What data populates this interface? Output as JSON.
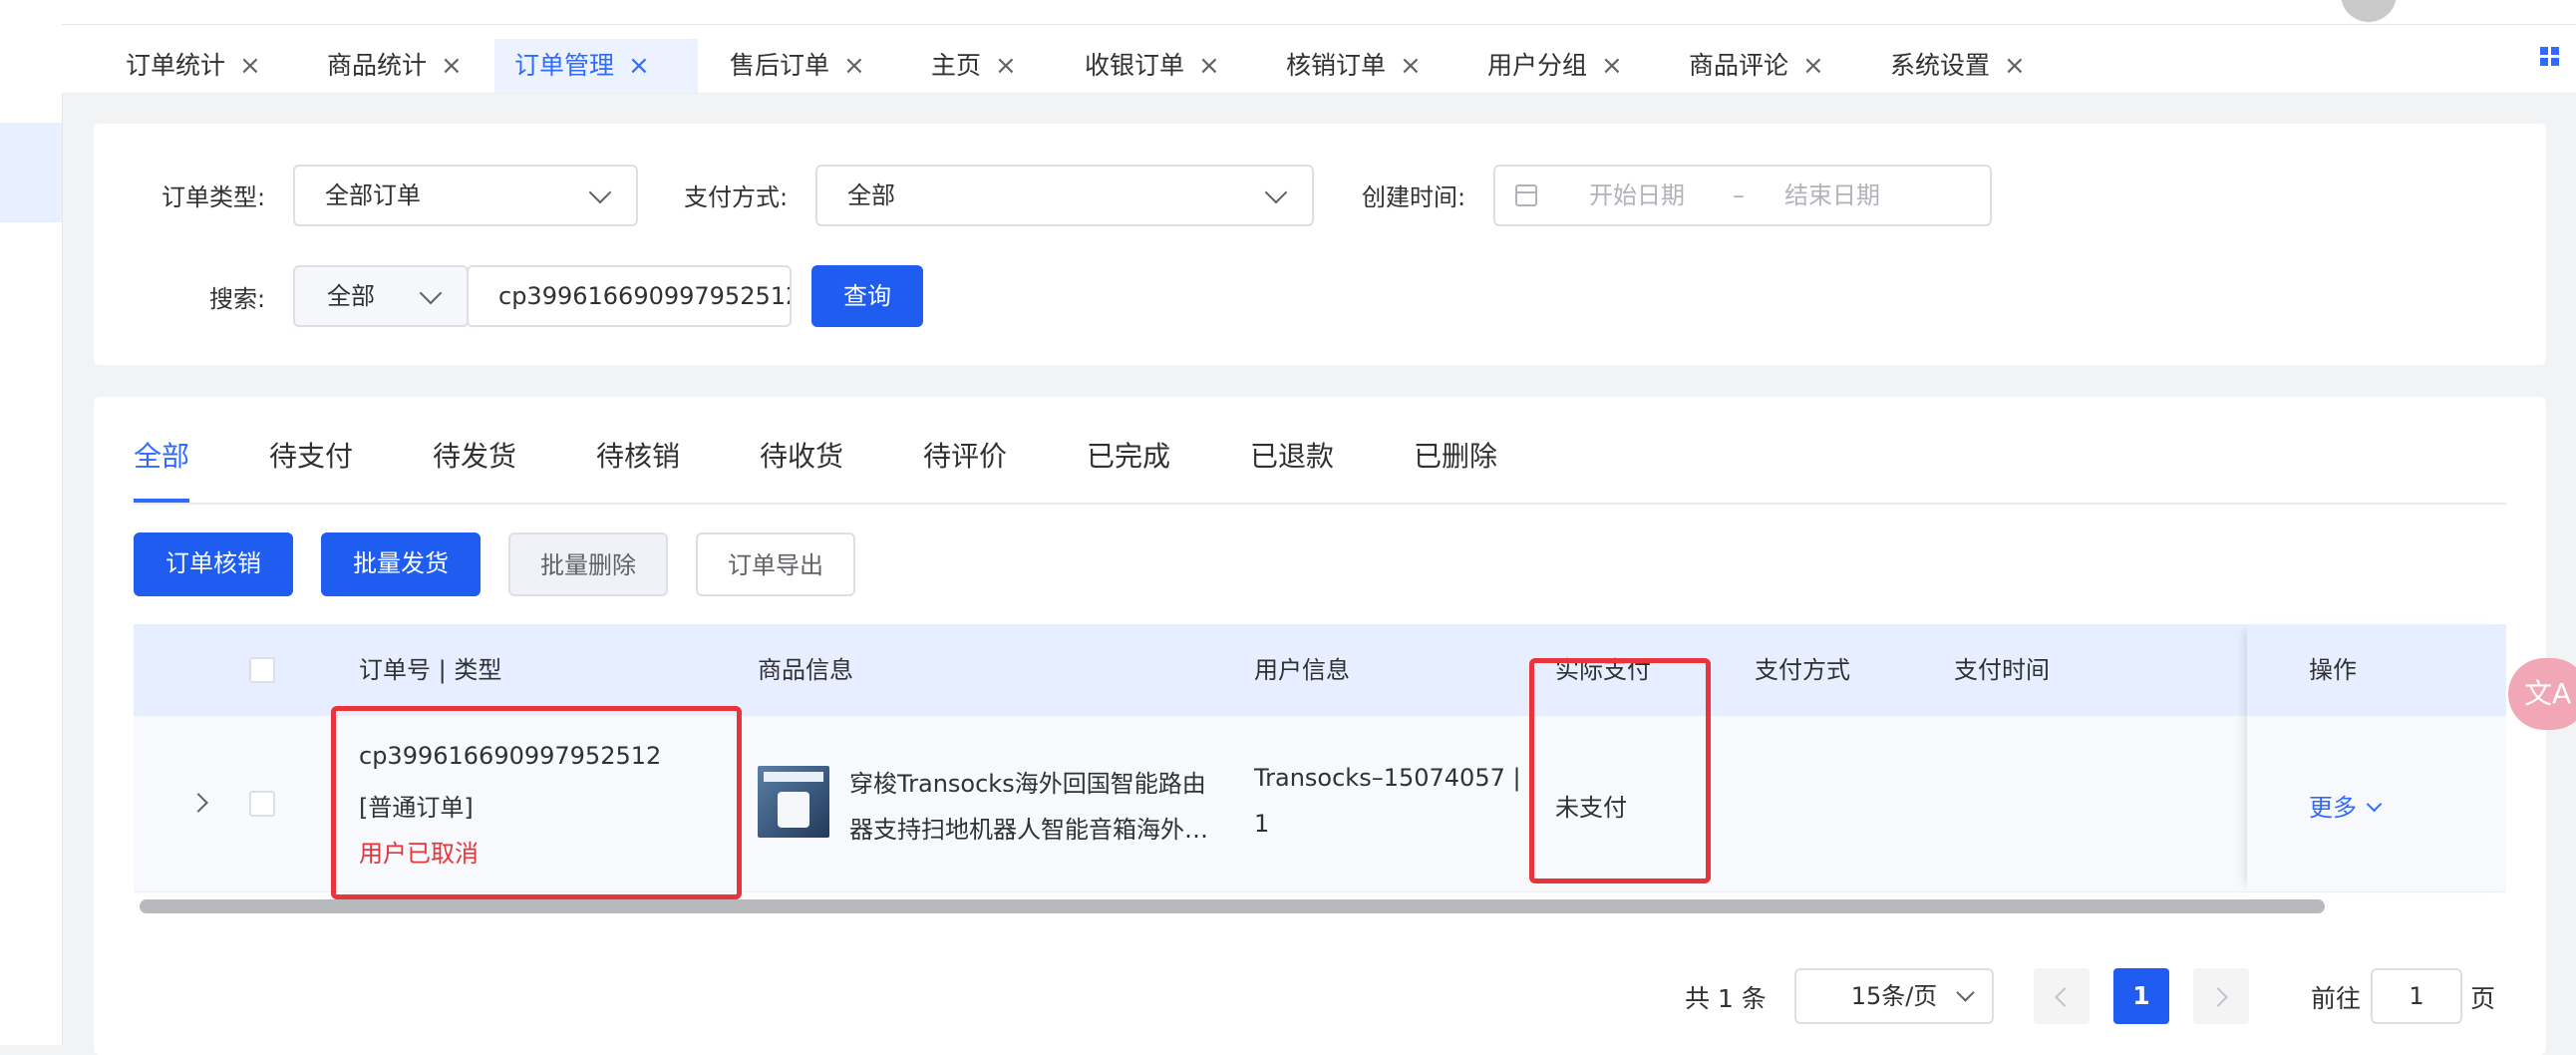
{
  "tabs": [
    {
      "label": "订单统计",
      "active": false
    },
    {
      "label": "商品统计",
      "active": false
    },
    {
      "label": "订单管理",
      "active": true
    },
    {
      "label": "售后订单",
      "active": false
    },
    {
      "label": "主页",
      "active": false
    },
    {
      "label": "收银订单",
      "active": false
    },
    {
      "label": "核销订单",
      "active": false
    },
    {
      "label": "用户分组",
      "active": false
    },
    {
      "label": "商品评论",
      "active": false
    },
    {
      "label": "系统设置",
      "active": false
    }
  ],
  "tab_close_glyph": "×",
  "filter": {
    "order_type_label": "订单类型:",
    "order_type_value": "全部订单",
    "pay_method_label": "支付方式:",
    "pay_method_value": "全部",
    "create_time_label": "创建时间:",
    "start_date_placeholder": "开始日期",
    "date_separator": "–",
    "end_date_placeholder": "结束日期",
    "search_label": "搜索:",
    "search_scope_value": "全部",
    "search_input_value": "cp399616690997952512",
    "query_button": "查询"
  },
  "status_tabs": [
    "全部",
    "待支付",
    "待发货",
    "待核销",
    "待收货",
    "待评价",
    "已完成",
    "已退款",
    "已删除"
  ],
  "active_status_tab": "全部",
  "actions": {
    "verify": "订单核销",
    "batch_ship": "批量发货",
    "batch_delete": "批量删除",
    "export": "订单导出"
  },
  "table": {
    "headers": {
      "order_no": "订单号 | 类型",
      "goods": "商品信息",
      "user": "用户信息",
      "paid": "实际支付",
      "pay_method": "支付方式",
      "pay_time": "支付时间",
      "ops": "操作"
    },
    "rows": [
      {
        "order_no": "cp399616690997952512",
        "order_type": "[普通订单]",
        "order_status": "用户已取消",
        "goods_line1": "穿梭Transocks海外回国智能路由",
        "goods_line2": "器支持扫地机器人智能音箱海外…",
        "user_line1": "Transocks–15074057 |",
        "user_line2": "1",
        "paid": "未支付",
        "pay_method": "",
        "pay_time": "",
        "more": "更多"
      }
    ]
  },
  "pagination": {
    "total": "共 1 条",
    "page_size": "15条/页",
    "current_page": "1",
    "goto_label": "前往",
    "goto_value": "1",
    "page_unit": "页"
  },
  "colors": {
    "primary": "#1f5cf0",
    "accent_text": "#2f6bff",
    "danger": "#e8343a",
    "header_bg": "#e6eeff"
  },
  "icons": {
    "expand": "chevron-right-icon",
    "dropdown": "chevron-down-icon",
    "calendar": "calendar-icon",
    "grid": "grid-icon",
    "translate": "translate-icon"
  }
}
